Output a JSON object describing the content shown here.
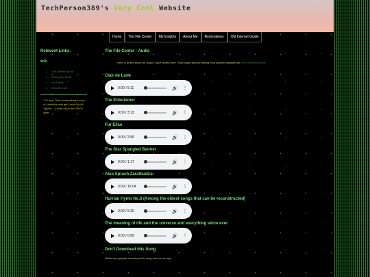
{
  "header": {
    "title_prefix": "TechPerson389's",
    "title_accent": "Very Cool",
    "title_suffix": "Website"
  },
  "nav": [
    {
      "label": "Home"
    },
    {
      "label": "The File Center"
    },
    {
      "label": "My Insights"
    },
    {
      "label": "About Me"
    },
    {
      "label": "Restorations"
    },
    {
      "label": "Old Internet Guide"
    }
  ],
  "sidebar": {
    "heading": "Relevent Links:",
    "sub": "wiz.",
    "links": [
      "The Internet Archi",
      "Dont grant kinda",
      "GeoCities",
      "Neocities.net"
    ],
    "quote": "\"Oh boy! Time to download a sexy-ol LimeWire and get Louie Ryu'd! Yippie!\" - 9 year old in the 2000s wide"
  },
  "main": {
    "title": "The File Center - Audio",
    "intro": "Here is where yours for audio I have stored here. They might also be linking from another website like",
    "intro_link": "The Internet Archive",
    "tracks": [
      {
        "title": "Clair de Lune",
        "time": "0:00 / 5:11"
      },
      {
        "title": "The Entertainer",
        "time": "0:00 / 3:13"
      },
      {
        "title": "Fur Elise",
        "time": "0:00 / 2:56"
      },
      {
        "title": "The Star Spangled Banner",
        "time": "0:00 / 1:17"
      },
      {
        "title": "Also Sprach Zarathustra",
        "time": "0:00 / 16:04"
      },
      {
        "title": "Hurrian Hymn No.6 (Among the oldest songs that can be reconstructed)",
        "time": "0:00 / 5:20"
      },
      {
        "title": "The meaning of life and the universe and everything since ever",
        "time": "0:00 / 0:00"
      },
      {
        "title": "Don't Download this Song",
        "time": ""
      }
    ],
    "note": "Weird error people download this song back in the day"
  },
  "icons": {
    "volume": "volume-icon",
    "more": "more-options-icon",
    "play": "play-icon"
  }
}
